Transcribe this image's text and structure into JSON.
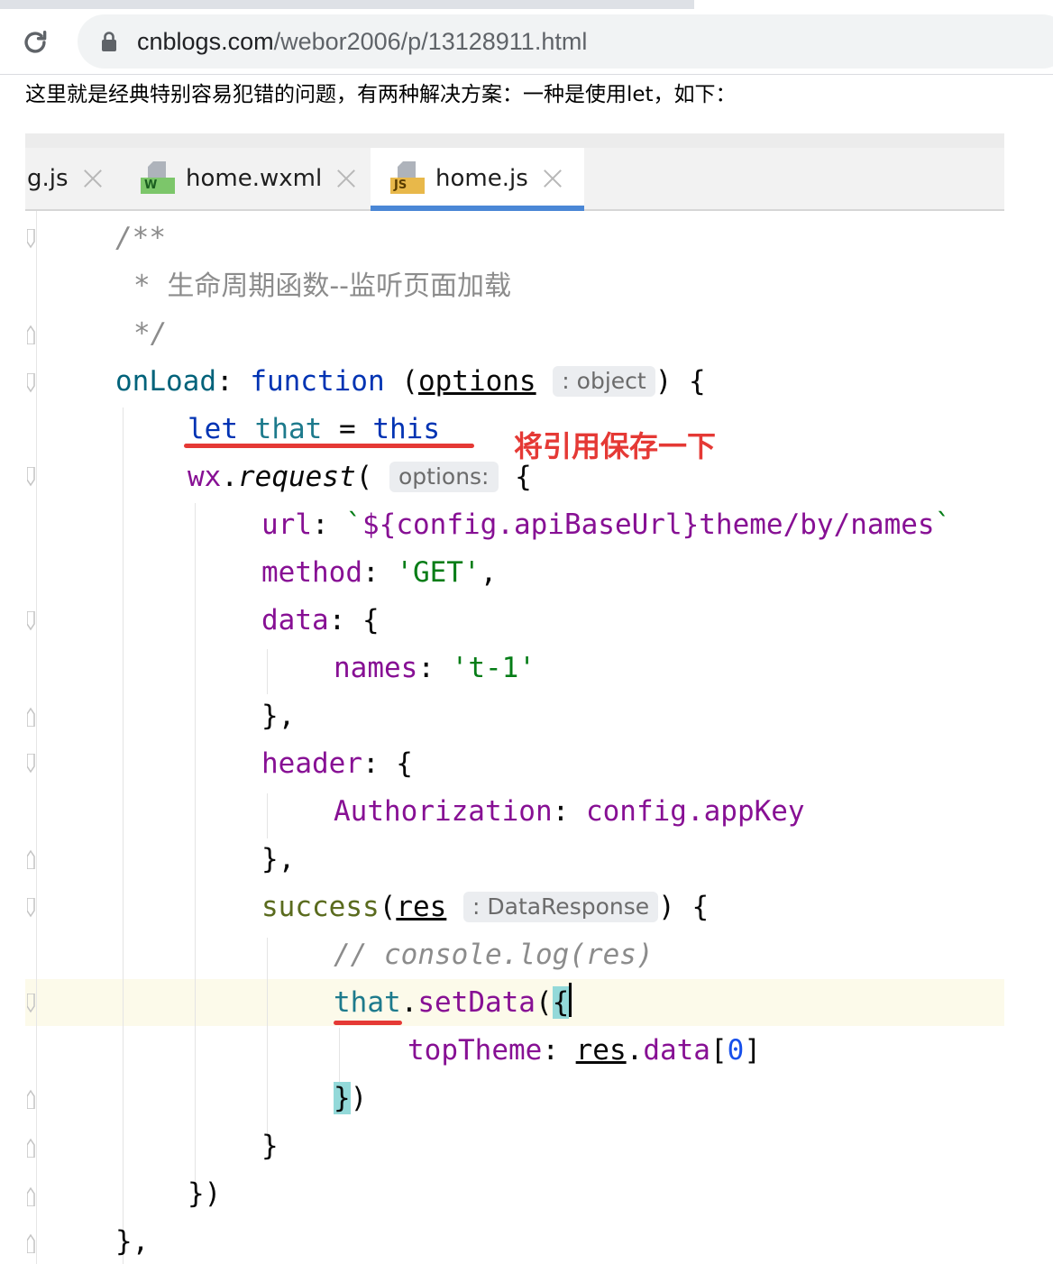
{
  "browser": {
    "url_host": "cnblogs.com",
    "url_path": "/webor2006/p/13128911.html"
  },
  "article": {
    "intro": "这里就是经典特别容易犯错的问题，有两种解决方案：一种是使用let，如下："
  },
  "editor": {
    "tabs": [
      {
        "label": "g.js",
        "icon": "js-file-icon"
      },
      {
        "label": "home.wxml",
        "icon": "wxml-file-icon",
        "badge": "W"
      },
      {
        "label": "home.js",
        "icon": "js-file-icon",
        "badge": "JS",
        "active": true
      }
    ],
    "hints": {
      "options_type": ": object",
      "request_param": "options:",
      "res_type": ": DataResponse"
    },
    "annotation": "将引用保存一下",
    "code": {
      "l1": "/**",
      "l2_star": "* ",
      "l2_text": "生命周期函数--监听页面加载",
      "l3": "*/",
      "onload": "onLoad",
      "function_kw": "function",
      "options": "options",
      "let": "let",
      "that": "that",
      "this": "this",
      "wx": "wx",
      "request": "request",
      "url_key": "url",
      "url_expr": "${config.apiBaseUrl}theme/by/names",
      "method_key": "method",
      "method_val": "'GET'",
      "data_key": "data",
      "names_key": "names",
      "names_val": "'t-1'",
      "header_key": "header",
      "auth_key": "Authorization",
      "auth_val": "config.appKey",
      "success": "success",
      "res": "res",
      "comment_log": "// console.log(res)",
      "setdata": "setData",
      "toptheme": "topTheme",
      "data_prop": "data",
      "zero": "0"
    }
  }
}
